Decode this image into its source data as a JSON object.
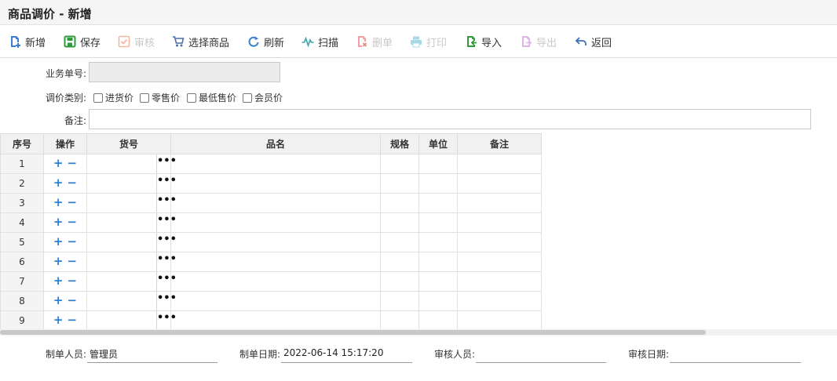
{
  "title": "商品调价 - 新增",
  "toolbar": [
    {
      "label": "新增",
      "icon": "new-doc-icon",
      "enabled": true
    },
    {
      "label": "保存",
      "icon": "save-icon",
      "enabled": true
    },
    {
      "label": "审核",
      "icon": "approve-icon",
      "enabled": false
    },
    {
      "label": "选择商品",
      "icon": "cart-icon",
      "enabled": true
    },
    {
      "label": "刷新",
      "icon": "refresh-icon",
      "enabled": true
    },
    {
      "label": "扫描",
      "icon": "scan-icon",
      "enabled": true
    },
    {
      "label": "删单",
      "icon": "delete-doc-icon",
      "enabled": false
    },
    {
      "label": "打印",
      "icon": "printer-icon",
      "enabled": false
    },
    {
      "label": "导入",
      "icon": "import-icon",
      "enabled": true
    },
    {
      "label": "导出",
      "icon": "export-icon",
      "enabled": false
    },
    {
      "label": "返回",
      "icon": "back-icon",
      "enabled": true
    }
  ],
  "form": {
    "order_no_label": "业务单号:",
    "order_no_value": "",
    "price_type_label": "调价类别:",
    "price_types": [
      {
        "label": "进货价",
        "checked": false
      },
      {
        "label": "零售价",
        "checked": false
      },
      {
        "label": "最低售价",
        "checked": false
      },
      {
        "label": "会员价",
        "checked": false
      }
    ],
    "remark_label": "备注:",
    "remark_value": ""
  },
  "grid": {
    "columns": [
      "序号",
      "操作",
      "货号",
      "品名",
      "规格",
      "单位",
      "备注"
    ],
    "rows": [
      "1",
      "2",
      "3",
      "4",
      "5",
      "6",
      "7",
      "8",
      "9"
    ],
    "add_symbol": "+",
    "remove_symbol": "−",
    "lookup_symbol": "•••"
  },
  "footer": {
    "creator_label": "制单人员:",
    "creator_value": "管理员",
    "create_date_label": "制单日期:",
    "create_date_value": "2022-06-14 15:17:20",
    "auditor_label": "审核人员:",
    "auditor_value": "",
    "audit_date_label": "审核日期:",
    "audit_date_value": ""
  },
  "colors": {
    "enabled_icon": "#3a7fcf",
    "disabled_icon": "#d0d0d0",
    "op_symbol": "#2b7fd6"
  }
}
